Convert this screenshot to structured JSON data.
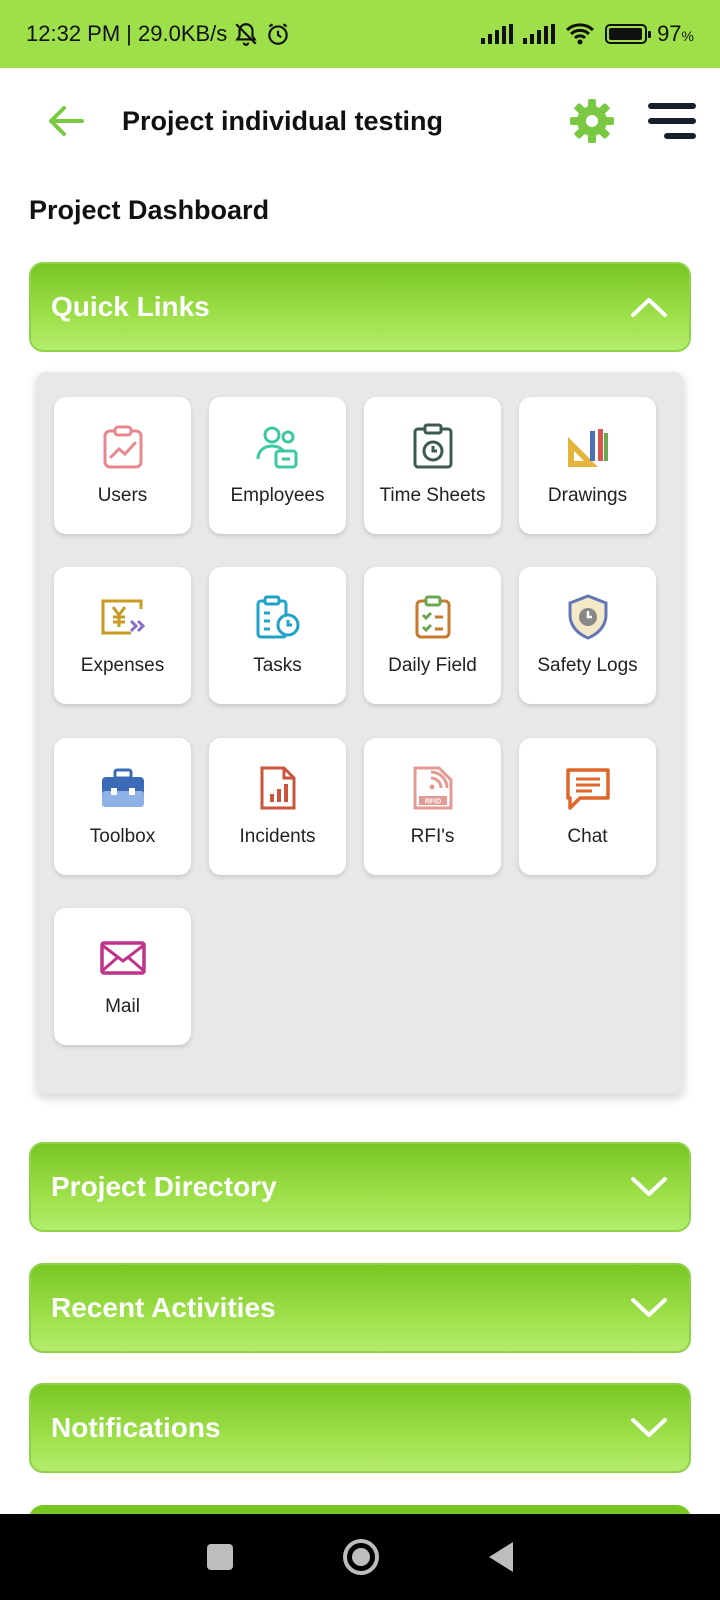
{
  "status_bar": {
    "time": "12:32 PM",
    "speed": "| 29.0KB/s",
    "battery": "97",
    "battery_unit": "%",
    "battery_level": 0.97
  },
  "app_bar": {
    "title": "Project individual testing",
    "back_icon": "arrow-left-icon",
    "settings_icon": "gear-icon",
    "menu_icon": "hamburger-menu-icon",
    "accent_color": "#7ac943"
  },
  "section_title": "Project Dashboard",
  "quick_links": {
    "label": "Quick Links",
    "expanded": true,
    "items": [
      {
        "label": "Users",
        "icon": "users-clipboard-icon"
      },
      {
        "label": "Employees",
        "icon": "employees-icon"
      },
      {
        "label": "Time Sheets",
        "icon": "timesheet-icon"
      },
      {
        "label": "Drawings",
        "icon": "drawings-icon"
      },
      {
        "label": "Expenses",
        "icon": "expenses-icon"
      },
      {
        "label": "Tasks",
        "icon": "tasks-icon"
      },
      {
        "label": "Daily Field",
        "icon": "daily-field-icon"
      },
      {
        "label": "Safety Logs",
        "icon": "safety-shield-icon"
      },
      {
        "label": "Toolbox",
        "icon": "toolbox-icon"
      },
      {
        "label": "Incidents",
        "icon": "incidents-report-icon"
      },
      {
        "label": "RFI's",
        "icon": "rfi-icon"
      },
      {
        "label": "Chat",
        "icon": "chat-icon"
      },
      {
        "label": "Mail",
        "icon": "mail-icon"
      }
    ]
  },
  "sections": [
    {
      "label": "Project Directory"
    },
    {
      "label": "Recent Activities"
    },
    {
      "label": "Notifications"
    }
  ],
  "header_gradient": [
    "#79c623",
    "#b4ec6d"
  ]
}
